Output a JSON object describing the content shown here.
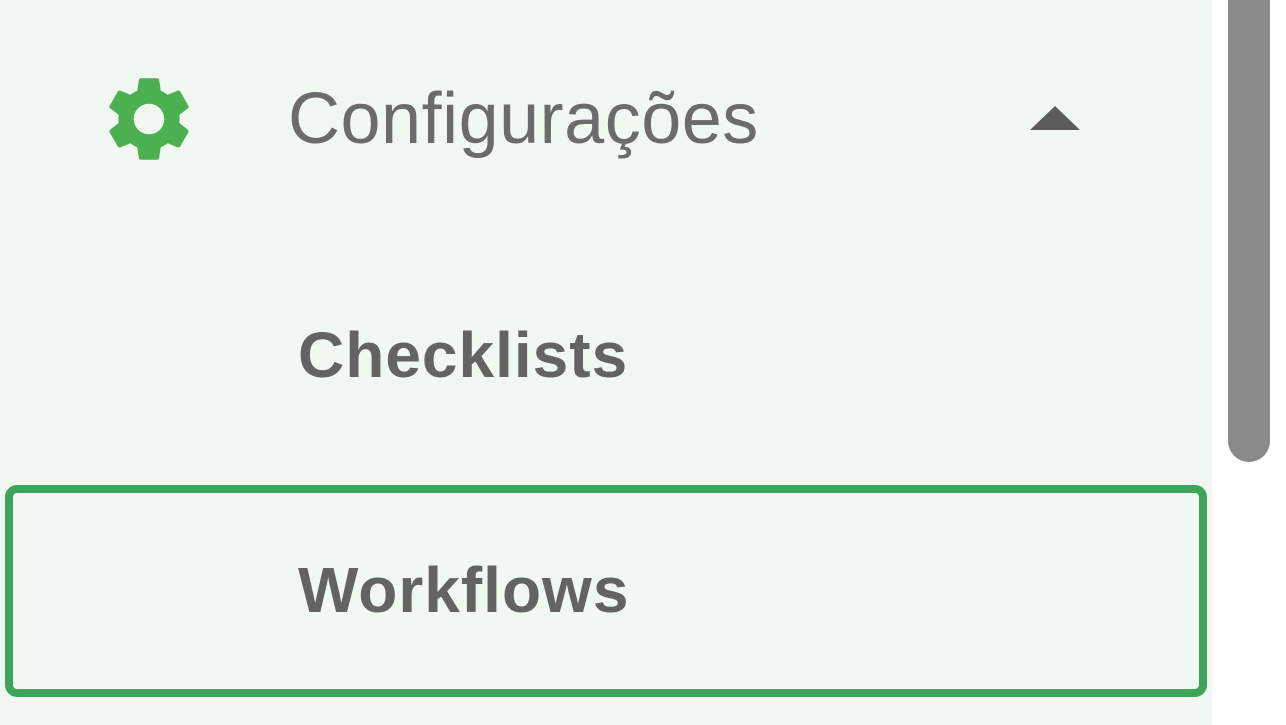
{
  "menu": {
    "section_label": "Configurações",
    "section_icon": "gear-icon",
    "toggle_icon": "caret-up-icon",
    "expanded": true,
    "items": [
      {
        "label": "Checklists",
        "selected": false
      },
      {
        "label": "Workflows",
        "selected": true
      }
    ]
  },
  "colors": {
    "sidebar_background": "#f1f8f1",
    "icon_green": "#4caf50",
    "selected_border": "#3fa35c",
    "text_gray": "#636363",
    "scrollbar_thumb": "#8a8a8a"
  }
}
